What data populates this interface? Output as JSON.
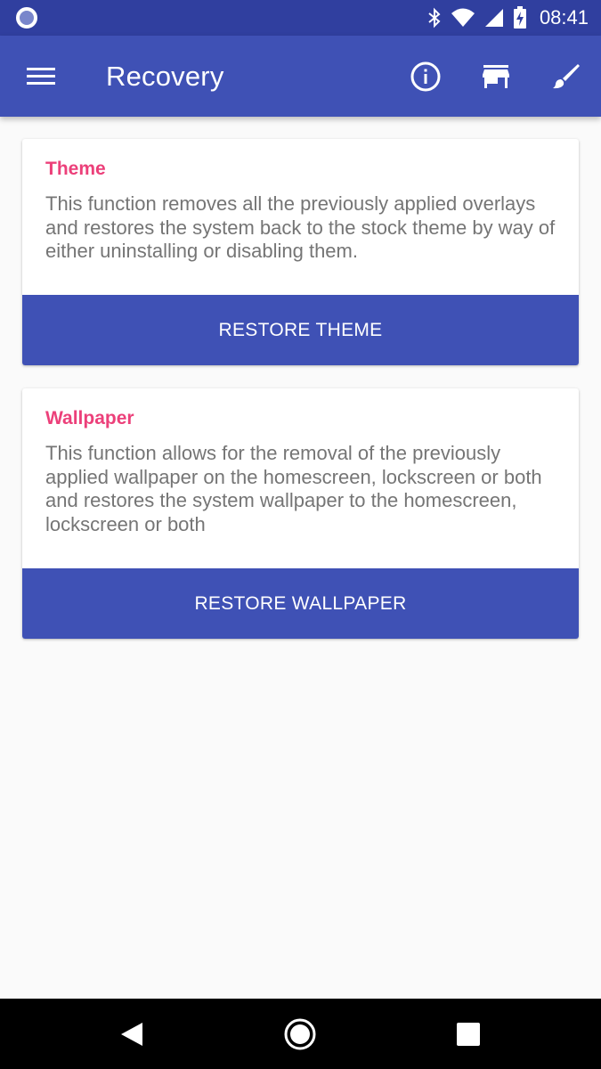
{
  "status_bar": {
    "time": "08:41",
    "icons": [
      "app-indicator-icon",
      "bluetooth-icon",
      "wifi-icon",
      "cell-signal-icon",
      "battery-charging-icon"
    ]
  },
  "app_bar": {
    "title": "Recovery",
    "icons": [
      "menu-icon",
      "info-icon",
      "store-icon",
      "brush-icon"
    ]
  },
  "cards": [
    {
      "title": "Theme",
      "description": "This function removes all the previously applied overlays and restores the system back to the stock theme by way of either uninstalling or disabling them.",
      "button_label": "RESTORE THEME"
    },
    {
      "title": "Wallpaper",
      "description": "This function allows for the removal of the previously applied wallpaper on the homescreen, lockscreen or both and restores the system wallpaper to the homescreen, lockscreen or both",
      "button_label": "RESTORE WALLPAPER"
    }
  ],
  "nav_bar": {
    "icons": [
      "back-icon",
      "home-icon",
      "recents-icon"
    ]
  },
  "colors": {
    "primary": "#3f51b5",
    "primary_dark": "#303f9f",
    "accent": "#ec407a",
    "background": "#fafafa",
    "description_text": "#757575"
  }
}
